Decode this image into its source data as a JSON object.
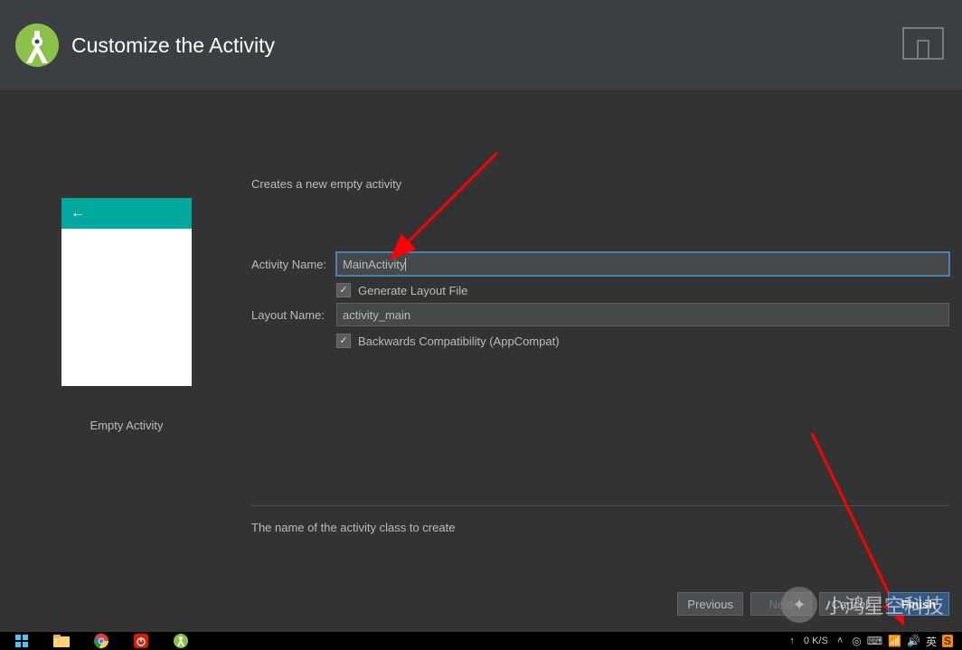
{
  "header": {
    "title": "Customize the Activity"
  },
  "preview": {
    "caption": "Empty Activity"
  },
  "form": {
    "intro": "Creates a new empty activity",
    "activity_name_label": "Activity Name:",
    "activity_name_value": "MainActivity",
    "generate_layout_label": "Generate Layout File",
    "layout_name_label": "Layout Name:",
    "layout_name_value": "activity_main",
    "backwards_compat_label": "Backwards Compatibility (AppCompat)",
    "hint": "The name of the activity class to create"
  },
  "buttons": {
    "previous": "Previous",
    "next": "Next",
    "cancel": "Cancel",
    "finish": "Finish"
  },
  "taskbar": {
    "net_speed": "0 K/S",
    "ime": "英"
  },
  "watermark": {
    "text": "小鸿星空科技"
  }
}
